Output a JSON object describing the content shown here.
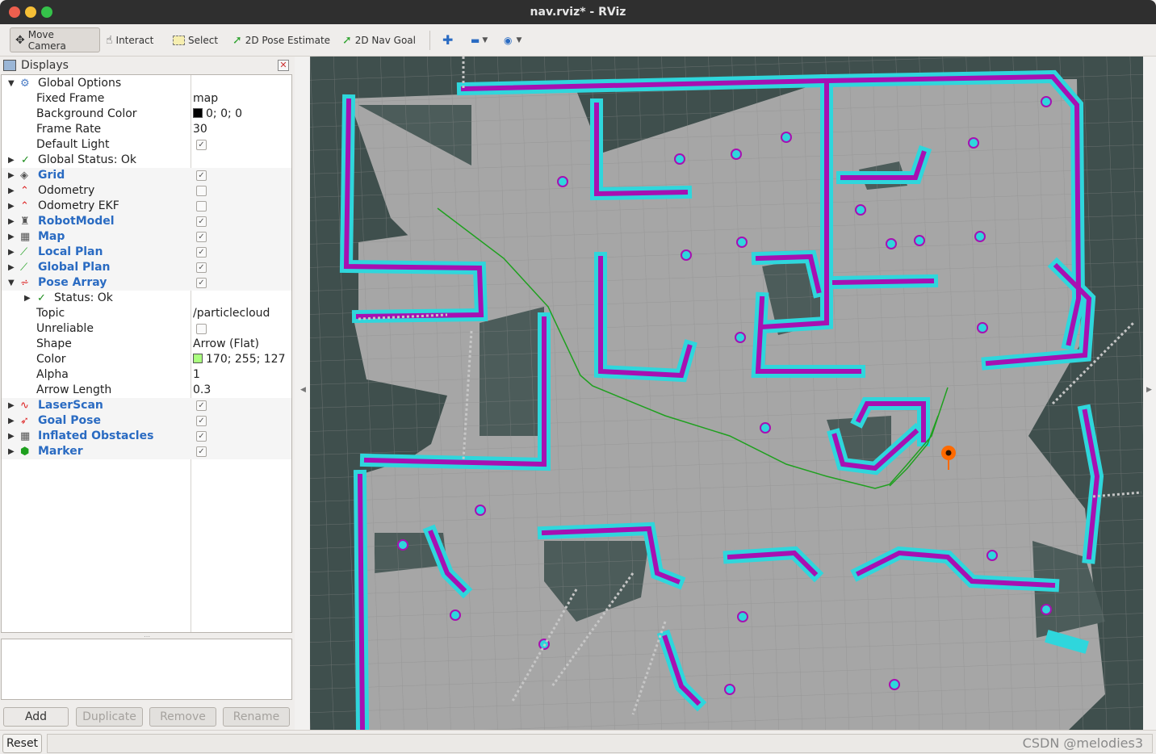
{
  "window": {
    "title": "nav.rviz* - RViz"
  },
  "toolbar": {
    "move_camera": "Move Camera",
    "interact": "Interact",
    "select": "Select",
    "pose_estimate": "2D Pose Estimate",
    "nav_goal": "2D Nav Goal"
  },
  "displays": {
    "title": "Displays",
    "global_options": "Global Options",
    "fixed_frame_label": "Fixed Frame",
    "fixed_frame_value": "map",
    "background_color_label": "Background Color",
    "background_color_value": "0; 0; 0",
    "frame_rate_label": "Frame Rate",
    "frame_rate_value": "30",
    "default_light_label": "Default Light",
    "global_status": "Global Status: Ok",
    "grid": "Grid",
    "odometry": "Odometry",
    "odometry_ekf": "Odometry EKF",
    "robot_model": "RobotModel",
    "map": "Map",
    "local_plan": "Local Plan",
    "global_plan": "Global Plan",
    "pose_array": "Pose Array",
    "status_ok": "Status: Ok",
    "topic_label": "Topic",
    "topic_value": "/particlecloud",
    "unreliable_label": "Unreliable",
    "shape_label": "Shape",
    "shape_value": "Arrow (Flat)",
    "color_label": "Color",
    "color_value": "170; 255; 127",
    "alpha_label": "Alpha",
    "alpha_value": "1",
    "arrow_length_label": "Arrow Length",
    "arrow_length_value": "0.3",
    "laser_scan": "LaserScan",
    "goal_pose": "Goal Pose",
    "inflated_obstacles": "Inflated Obstacles",
    "marker": "Marker"
  },
  "buttons": {
    "add": "Add",
    "duplicate": "Duplicate",
    "remove": "Remove",
    "rename": "Rename",
    "reset": "Reset"
  },
  "watermark": "CSDN @melodies3",
  "colors": {
    "background_swatch": "#000000",
    "pose_array_swatch": "#aaff7f",
    "map_dark": "#3f4f4d",
    "map_free": "#a6a6a6",
    "costmap_cyan": "#2fd6dc",
    "costmap_magenta": "#a710b2",
    "path_green": "#1fa01f",
    "goal_orange": "#ff6a00"
  }
}
